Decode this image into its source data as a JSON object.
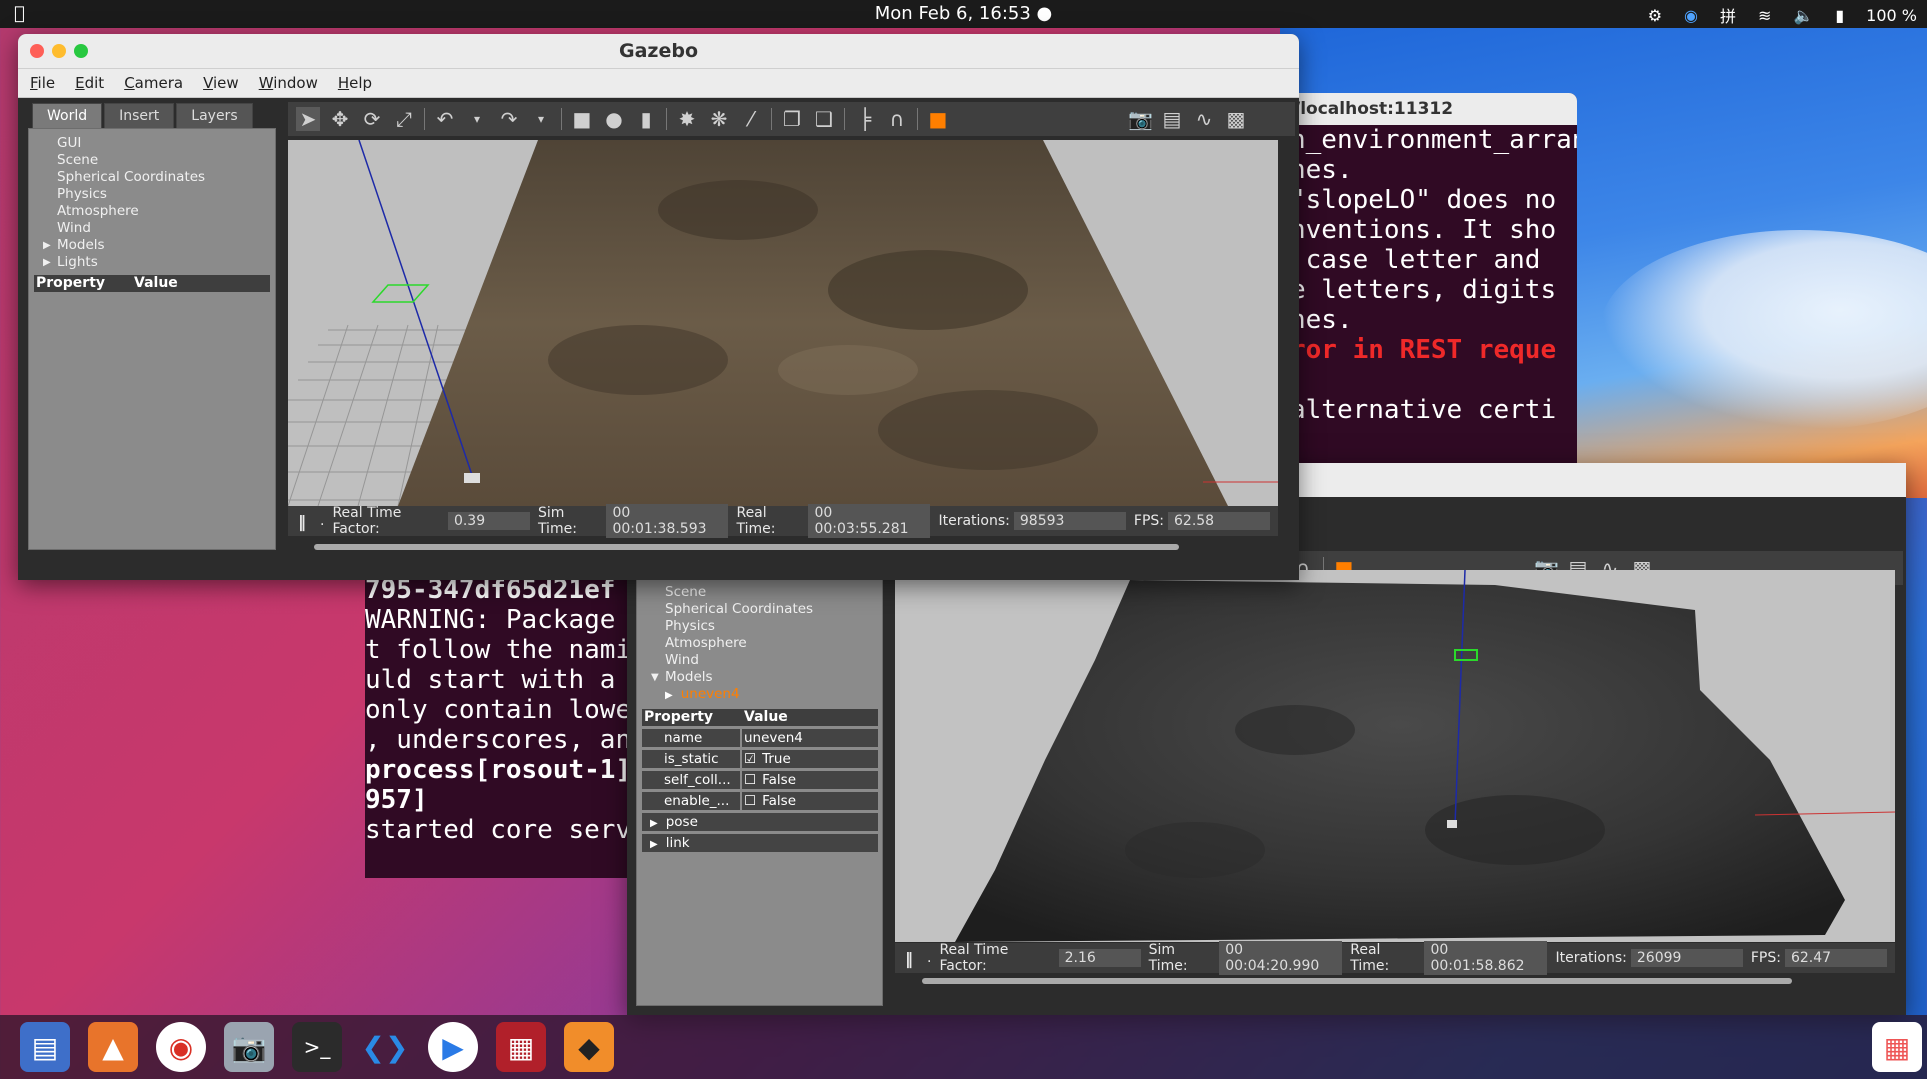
{
  "topbar": {
    "apple": "",
    "clock": "Mon Feb  6, 16:53 ●",
    "battery": "100 %",
    "keyboard": "拼"
  },
  "terminal_back": {
    "title": "/localhost:11312",
    "lines": [
      {
        "text": "n_environment_arrang",
        "style": "normal"
      },
      {
        "text": "hes.",
        "style": "normal"
      },
      {
        "text": "\"slopeLO\" does no",
        "style": "normal"
      },
      {
        "text": "nventions. It sho",
        "style": "normal"
      },
      {
        "text": " case letter and",
        "style": "normal"
      },
      {
        "text": "e letters, digits",
        "style": "normal"
      },
      {
        "text": "hes.",
        "style": "normal"
      },
      {
        "text": "ror in REST reque",
        "style": "red"
      },
      {
        "text": "",
        "style": "normal"
      },
      {
        "text": "alternative certi",
        "style": "normal"
      }
    ]
  },
  "terminal_front": {
    "lines": [
      {
        "text": "795-347df65d21ef",
        "style": "bold"
      },
      {
        "text": "WARNING: Package n",
        "style": "normal"
      },
      {
        "text": "t follow the namin",
        "style": "normal"
      },
      {
        "text": "uld start with a l",
        "style": "normal"
      },
      {
        "text": "only contain lower",
        "style": "normal"
      },
      {
        "text": ", underscores, and",
        "style": "normal"
      },
      {
        "text": "process[rosout-1]",
        "style": "bold"
      },
      {
        "text": "957]",
        "style": "bold"
      },
      {
        "text": "started core servi",
        "style": "normal"
      }
    ]
  },
  "gazebo1": {
    "title": "Gazebo",
    "menu": [
      "File",
      "Edit",
      "Camera",
      "View",
      "Window",
      "Help"
    ],
    "tabs": [
      "World",
      "Insert",
      "Layers"
    ],
    "tree": [
      {
        "label": "GUI",
        "arrow": ""
      },
      {
        "label": "Scene",
        "arrow": ""
      },
      {
        "label": "Spherical Coordinates",
        "arrow": ""
      },
      {
        "label": "Physics",
        "arrow": ""
      },
      {
        "label": "Atmosphere",
        "arrow": ""
      },
      {
        "label": "Wind",
        "arrow": ""
      },
      {
        "label": "Models",
        "arrow": "▶"
      },
      {
        "label": "Lights",
        "arrow": "▶"
      }
    ],
    "prop_header": {
      "property": "Property",
      "value": "Value"
    },
    "status": {
      "rtf_label": "Real Time Factor:",
      "rtf": "0.39",
      "sim_label": "Sim Time:",
      "sim": "00 00:01:38.593",
      "real_label": "Real Time:",
      "real": "00 00:03:55.281",
      "iter_label": "Iterations:",
      "iter": "98593",
      "fps_label": "FPS:",
      "fps": "62.58"
    }
  },
  "gazebo2": {
    "tree": [
      {
        "label": "Scene",
        "arrow": ""
      },
      {
        "label": "Spherical Coordinates",
        "arrow": ""
      },
      {
        "label": "Physics",
        "arrow": ""
      },
      {
        "label": "Atmosphere",
        "arrow": ""
      },
      {
        "label": "Wind",
        "arrow": ""
      },
      {
        "label": "Models",
        "arrow": "▼"
      }
    ],
    "selected_model": "uneven4",
    "prop_header": {
      "property": "Property",
      "value": "Value"
    },
    "props": [
      {
        "name": "name",
        "value": "uneven4",
        "check": ""
      },
      {
        "name": "is_static",
        "value": "True",
        "check": "☑"
      },
      {
        "name": "self_coll...",
        "value": "False",
        "check": "☐"
      },
      {
        "name": "enable_...",
        "value": "False",
        "check": "☐"
      }
    ],
    "groups": [
      "pose",
      "link"
    ],
    "status": {
      "rtf_label": "Real Time Factor:",
      "rtf": "2.16",
      "sim_label": "Sim Time:",
      "sim": "00 00:04:20.990",
      "real_label": "Real Time:",
      "real": "00 00:01:58.862",
      "iter_label": "Iterations:",
      "iter": "26099",
      "fps_label": "FPS:",
      "fps": "62.47"
    }
  },
  "colors": {
    "terminal_bg": "#300a24",
    "gazebo_bg": "#2c2c2c",
    "accent_orange": "#ff7f00",
    "error_red": "#ef2929"
  }
}
